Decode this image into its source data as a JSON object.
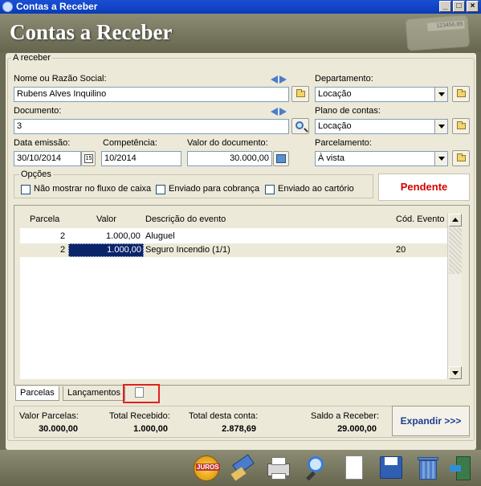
{
  "window": {
    "title": "Contas a Receber"
  },
  "header": {
    "title": "Contas a Receber",
    "decor_display": "123456.89"
  },
  "group": {
    "legend": "A receber"
  },
  "form": {
    "nome": {
      "label": "Nome ou Razão Social:",
      "value": "Rubens Alves Inquilino"
    },
    "documento": {
      "label": "Documento:",
      "value": "3"
    },
    "data_emissao": {
      "label": "Data emissão:",
      "value": "30/10/2014"
    },
    "competencia": {
      "label": "Competência:",
      "value": "10/2014"
    },
    "valor_documento": {
      "label": "Valor do documento:",
      "value": "30.000,00"
    },
    "departamento": {
      "label": "Departamento:",
      "value": "Locação"
    },
    "plano_contas": {
      "label": "Plano de contas:",
      "value": "Locação"
    },
    "parcelamento": {
      "label": "Parcelamento:",
      "value": "À vista"
    }
  },
  "opcoes": {
    "legend": "Opções",
    "items": [
      {
        "label": "Não mostrar no fluxo de caixa",
        "checked": false
      },
      {
        "label": "Enviado para cobrança",
        "checked": false
      },
      {
        "label": "Enviado ao cartório",
        "checked": false
      }
    ]
  },
  "status": {
    "text": "Pendente",
    "color": "#d40000"
  },
  "grid": {
    "columns": [
      "Parcela",
      "Valor",
      "Descrição do evento",
      "Cód. Evento"
    ],
    "rows": [
      {
        "parcela": "2",
        "valor": "1.000,00",
        "descricao": "Aluguel",
        "cod": ""
      },
      {
        "parcela": "2",
        "valor": "1.000,00",
        "descricao": "Seguro Incendio (1/1)",
        "cod": "20"
      }
    ]
  },
  "tabs": [
    {
      "label": "Parcelas"
    },
    {
      "label": "Lançamentos"
    }
  ],
  "totals": {
    "valor_parcelas": {
      "label": "Valor Parcelas:",
      "value": "30.000,00"
    },
    "total_recebido": {
      "label": "Total Recebido:",
      "value": "1.000,00"
    },
    "total_conta": {
      "label": "Total desta conta:",
      "value": "2.878,69"
    },
    "saldo": {
      "label": "Saldo a Receber:",
      "value": "29.000,00"
    }
  },
  "expand_button": {
    "label": "Expandir  >>>"
  },
  "toolbar": {
    "juros_label": "JUROS",
    "icons": [
      "juros-icon",
      "clean-icon",
      "print-icon",
      "search-icon",
      "new-document-icon",
      "save-icon",
      "trash-icon",
      "exit-icon"
    ]
  },
  "colors": {
    "accent": "#0a3bb8",
    "panel": "#ece9d8",
    "frame": "#6b6b56",
    "status": "#d40000"
  }
}
